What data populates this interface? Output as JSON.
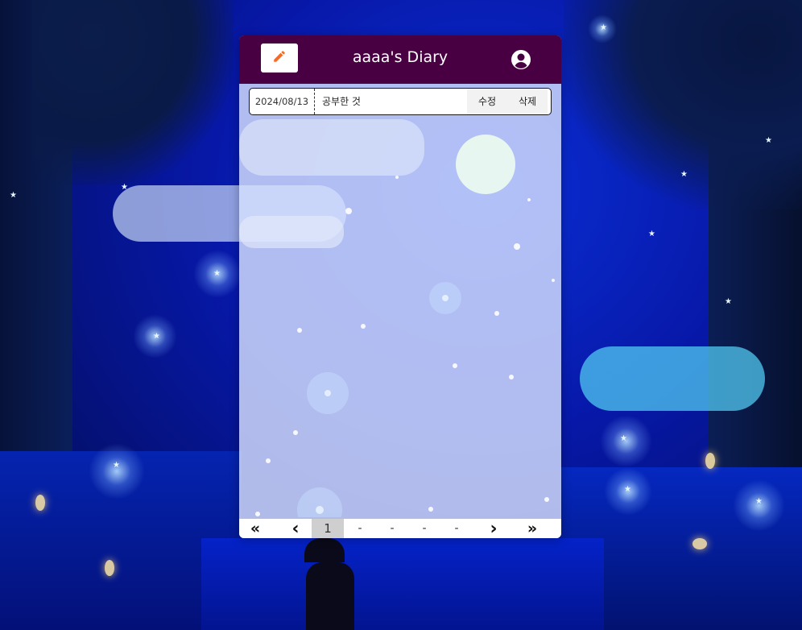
{
  "header": {
    "title": "aaaa's Diary",
    "edit_icon": "pencil-icon",
    "profile_icon": "user-circle-icon",
    "bg_color": "#480042"
  },
  "entries": [
    {
      "date": "2024/08/13",
      "title": "공부한 것",
      "edit_label": "수정",
      "delete_label": "삭제"
    }
  ],
  "pagination": {
    "first_icon": "double-chevron-left-icon",
    "prev_icon": "chevron-left-icon",
    "next_icon": "chevron-right-icon",
    "last_icon": "double-chevron-right-icon",
    "first_glyph": "«",
    "prev_glyph": "‹",
    "next_glyph": "›",
    "last_glyph": "»",
    "pages": [
      "1",
      "-",
      "-",
      "-",
      "-"
    ],
    "current": "1"
  }
}
